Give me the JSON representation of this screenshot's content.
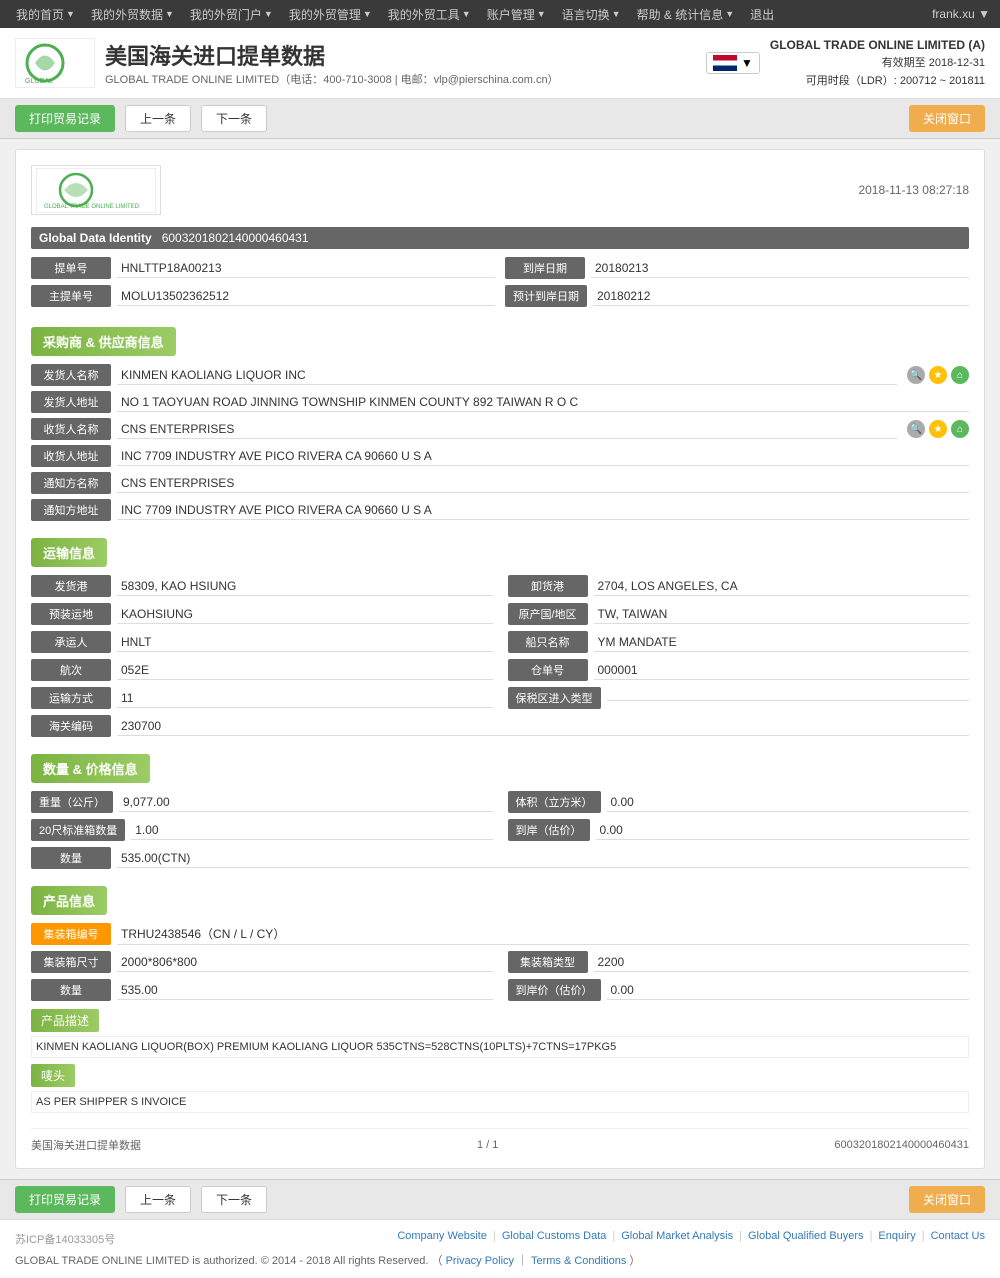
{
  "topnav": {
    "items": [
      {
        "label": "我的首页",
        "arrow": true
      },
      {
        "label": "我的外贸数据",
        "arrow": true
      },
      {
        "label": "我的外贸门户",
        "arrow": true
      },
      {
        "label": "我的外贸管理",
        "arrow": true
      },
      {
        "label": "我的外贸工具",
        "arrow": true
      },
      {
        "label": "账户管理",
        "arrow": true
      },
      {
        "label": "语言切换",
        "arrow": true
      },
      {
        "label": "帮助 & 统计信息",
        "arrow": true
      },
      {
        "label": "退出",
        "arrow": false
      }
    ],
    "user": "frank.xu ▼"
  },
  "header": {
    "title": "美国海关进口提单数据",
    "subtitle": "GLOBAL TRADE ONLINE LIMITED（电话：400-710-3008 | 电邮：vlp@pierschina.com.cn）",
    "company": "GLOBAL TRADE ONLINE LIMITED (A)",
    "expiry": "有效期至 2018-12-31",
    "ldr": "可用时段（LDR）: 200712 ~ 201811"
  },
  "toolbar": {
    "print_label": "打印贸易记录",
    "prev_label": "上一条",
    "next_label": "下一条",
    "close_label": "关闭窗口"
  },
  "document": {
    "datetime": "2018-11-13 08:27:18",
    "gdi_label": "Global Data Identity",
    "gdi_value": "6003201802140000460431",
    "fields": {
      "bill_number_label": "提单号",
      "bill_number": "HNLTTP18A00213",
      "arrival_date_label": "到岸日期",
      "arrival_date": "20180213",
      "master_bill_label": "主提单号",
      "master_bill": "MOLU13502362512",
      "estimated_arrival_label": "预计到岸日期",
      "estimated_arrival": "20180212"
    }
  },
  "buyer_supplier": {
    "section_label": "采购商 & 供应商信息",
    "sender_name_label": "发货人名称",
    "sender_name": "KINMEN KAOLIANG LIQUOR INC",
    "sender_addr_label": "发货人地址",
    "sender_addr": "NO 1 TAOYUAN ROAD JINNING TOWNSHIP KINMEN COUNTY 892 TAIWAN R O C",
    "receiver_name_label": "收货人名称",
    "receiver_name": "CNS ENTERPRISES",
    "receiver_addr_label": "收货人地址",
    "receiver_addr": "INC 7709 INDUSTRY AVE PICO RIVERA CA 90660 U S A",
    "notify_name_label": "通知方名称",
    "notify_name": "CNS ENTERPRISES",
    "notify_addr_label": "通知方地址",
    "notify_addr": "INC 7709 INDUSTRY AVE PICO RIVERA CA 90660 U S A"
  },
  "transport": {
    "section_label": "运输信息",
    "departure_port_label": "发货港",
    "departure_port": "58309, KAO HSIUNG",
    "arrival_port_label": "卸货港",
    "arrival_port": "2704, LOS ANGELES, CA",
    "loading_place_label": "预装运地",
    "loading_place": "KAOHSIUNG",
    "origin_label": "原产国/地区",
    "origin": "TW, TAIWAN",
    "carrier_label": "承运人",
    "carrier": "HNLT",
    "vessel_label": "船只名称",
    "vessel": "YM MANDATE",
    "voyage_label": "航次",
    "voyage": "052E",
    "warehouse_label": "仓单号",
    "warehouse": "000001",
    "transport_mode_label": "运输方式",
    "transport_mode": "11",
    "bonded_zone_label": "保税区进入类型",
    "bonded_zone": "",
    "customs_code_label": "海关编码",
    "customs_code": "230700"
  },
  "quantity_price": {
    "section_label": "数量 & 价格信息",
    "weight_label": "重量（公斤）",
    "weight": "9,077.00",
    "volume_label": "体积（立方米）",
    "volume": "0.00",
    "twenty_ft_label": "20尺标准箱数量",
    "twenty_ft": "1.00",
    "arrival_price_label": "到岸（估价）",
    "arrival_price": "0.00",
    "quantity_label": "数量",
    "quantity": "535.00(CTN)"
  },
  "product": {
    "section_label": "产品信息",
    "container_no_label": "集装箱编号",
    "container_no": "TRHU2438546（CN / L / CY）",
    "container_size_label": "集装箱尺寸",
    "container_size": "2000*806*800",
    "container_type_label": "集装箱类型",
    "container_type": "2200",
    "quantity_label": "数量",
    "quantity": "535.00",
    "arrival_price_label": "到岸价（估价）",
    "arrival_price": "0.00",
    "desc_label": "产品描述",
    "desc_content": "KINMEN KAOLIANG LIQUOR(BOX) PREMIUM KAOLIANG LIQUOR 535CTNS=528CTNS(10PLTS)+7CTNS=17PKG5",
    "marks_label": "唛头",
    "marks_content": "AS PER SHIPPER S INVOICE"
  },
  "doc_footer": {
    "title": "美国海关进口提单数据",
    "pagination": "1 / 1",
    "gdi": "6003201802140000460431"
  },
  "page_footer": {
    "icp": "苏ICP备14033305号",
    "links": [
      "Company Website",
      "Global Customs Data",
      "Global Market Analysis",
      "Global Qualified Buyers",
      "Enquiry",
      "Contact Us"
    ],
    "copyright": "GLOBAL TRADE ONLINE LIMITED is authorized. © 2014 - 2018 All rights Reserved.",
    "privacy": "Privacy Policy",
    "terms": "Terms & Conditions"
  }
}
